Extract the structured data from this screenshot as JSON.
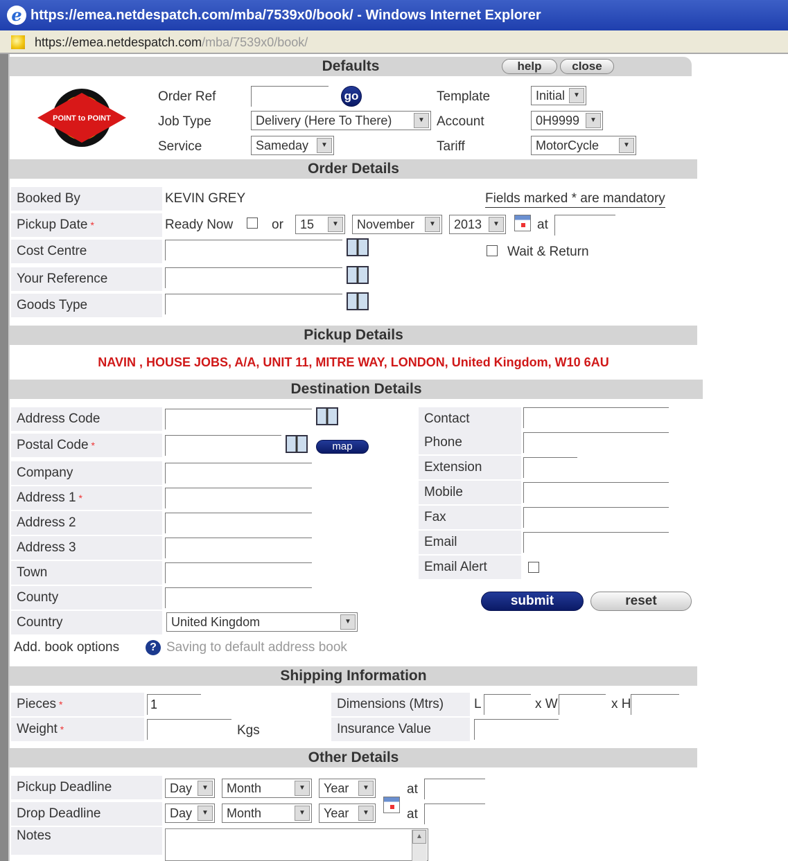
{
  "window": {
    "title": "https://emea.netdespatch.com/mba/7539x0/book/ - Windows Internet Explorer"
  },
  "address_bar": {
    "host": "https://emea.netdespatch.com",
    "path": "/mba/7539x0/book/"
  },
  "defaults": {
    "section_title": "Defaults",
    "help_label": "help",
    "close_label": "close",
    "order_ref_label": "Order Ref",
    "go_label": "go",
    "job_type_label": "Job Type",
    "job_type_value": "Delivery (Here To There)",
    "service_label": "Service",
    "service_value": "Sameday",
    "template_label": "Template",
    "template_value": "Initial",
    "account_label": "Account",
    "account_value": "0H9999",
    "tariff_label": "Tariff",
    "tariff_value": "MotorCycle"
  },
  "order": {
    "section_title": "Order Details",
    "booked_by_label": "Booked By",
    "booked_by_value": "KEVIN GREY",
    "mandatory_note": "Fields marked * are mandatory",
    "pickup_date_label": "Pickup Date",
    "ready_now_label": "Ready Now",
    "or_label": "or",
    "day": "15",
    "month": "November",
    "year": "2013",
    "at_label": "at",
    "cost_centre_label": "Cost Centre",
    "wait_return_label": "Wait & Return",
    "your_reference_label": "Your Reference",
    "goods_type_label": "Goods Type"
  },
  "pickup": {
    "section_title": "Pickup Details",
    "address": "NAVIN , HOUSE JOBS, A/A, UNIT 11, MITRE WAY, LONDON, United Kingdom, W10 6AU"
  },
  "destination": {
    "section_title": "Destination Details",
    "address_code_label": "Address Code",
    "postal_code_label": "Postal Code",
    "map_label": "map",
    "company_label": "Company",
    "address1_label": "Address 1",
    "address2_label": "Address 2",
    "address3_label": "Address 3",
    "town_label": "Town",
    "county_label": "County",
    "country_label": "Country",
    "country_value": "United Kingdom",
    "add_book_label": "Add. book options",
    "add_book_note": "Saving to default address book",
    "contact_label": "Contact",
    "phone_label": "Phone",
    "extension_label": "Extension",
    "mobile_label": "Mobile",
    "fax_label": "Fax",
    "email_label": "Email",
    "email_alert_label": "Email Alert",
    "submit_label": "submit",
    "reset_label": "reset"
  },
  "shipping": {
    "section_title": "Shipping Information",
    "pieces_label": "Pieces",
    "pieces_value": "1",
    "weight_label": "Weight",
    "kgs_label": "Kgs",
    "dimensions_label": "Dimensions (Mtrs)",
    "l_label": "L",
    "w_label": "x W",
    "h_label": "x H",
    "insurance_label": "Insurance Value"
  },
  "other": {
    "section_title": "Other Details",
    "pickup_deadline_label": "Pickup Deadline",
    "drop_deadline_label": "Drop Deadline",
    "day_placeholder": "Day",
    "month_placeholder": "Month",
    "year_placeholder": "Year",
    "at_label": "at",
    "notes_label": "Notes"
  },
  "logo": {
    "text": "POINT to POINT"
  }
}
